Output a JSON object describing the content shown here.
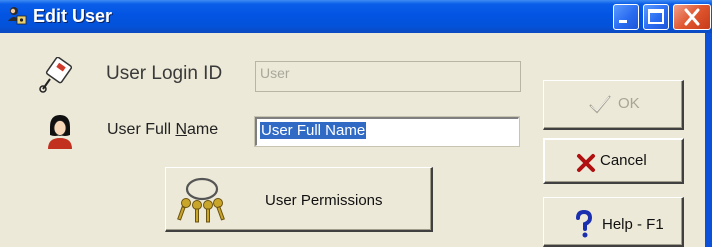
{
  "window": {
    "title": "Edit User"
  },
  "form": {
    "login_label": "User Login ID",
    "login_value": "User",
    "full_name_label_pre": "User Full ",
    "full_name_label_accel": "N",
    "full_name_label_post": "ame",
    "full_name_value": "User Full Name"
  },
  "buttons": {
    "permissions": "User Permissions",
    "ok": "OK",
    "cancel": "Cancel",
    "help": "Help - F1"
  },
  "icons": {
    "title": "users-icon",
    "login": "id-card-icon",
    "full_name": "person-icon",
    "permissions": "keys-icon",
    "ok": "checkmark-icon",
    "cancel": "x-icon",
    "help": "question-mark-icon"
  },
  "colors": {
    "titlebar": "#0354e3",
    "dialog_bg": "#ece9d8",
    "selection": "#316ac5",
    "cancel_x": "#b01010",
    "help_q": "#1a2fb0"
  }
}
